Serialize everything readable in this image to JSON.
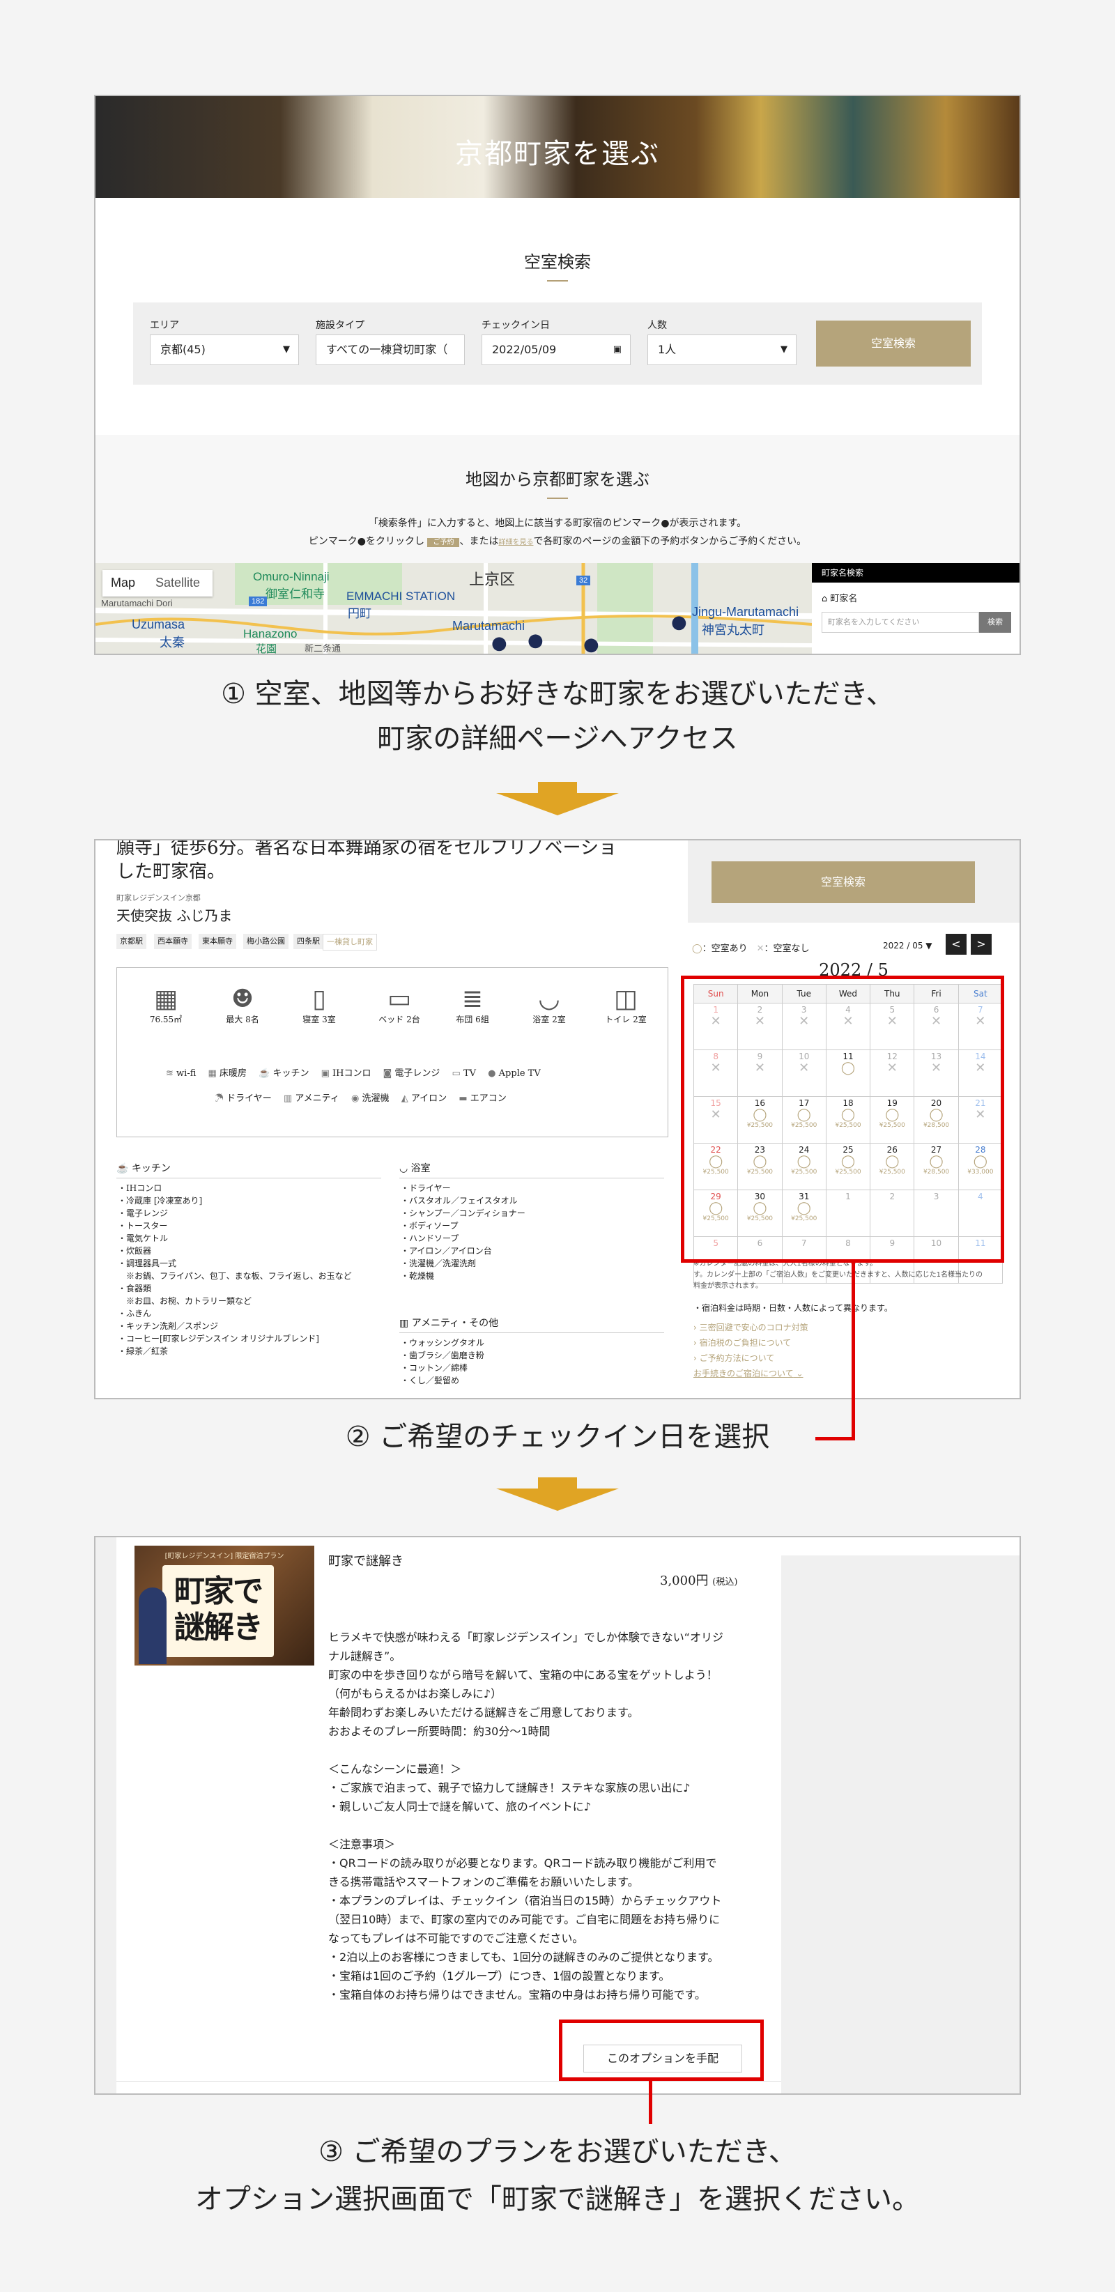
{
  "panel1": {
    "hero_title": "京都町家を選ぶ",
    "search_title": "空室検索",
    "fields": [
      {
        "label": "エリア",
        "value": "京都(45)"
      },
      {
        "label": "施設タイプ",
        "value": "すべての一棟貸切町家（"
      },
      {
        "label": "チェックイン日",
        "value": "2022/05/09"
      },
      {
        "label": "人数",
        "value": "1人"
      }
    ],
    "search_button": "空室検索",
    "map_section_title": "地図から京都町家を選ぶ",
    "map_instruction_1a": "「検索条件」に入力すると、地図上に該当する町家宿のピンマーク",
    "map_instruction_1b": "が表示されます。",
    "map_instruction_2a": "ピンマーク",
    "map_instruction_2b": "をクリックし",
    "map_instruction_2_badge": "ご予約",
    "map_instruction_2c": "、または",
    "map_instruction_2_link": "詳細を見る",
    "map_instruction_2d": "で各町家のページの金額下の予約ボタンからご予約ください。",
    "map_tabs": [
      "Map",
      "Satellite"
    ],
    "map_labels": [
      "Marutamachi Dori",
      "Omuro-Ninnaji",
      "御室仁和寺",
      "EMMACHI STATION",
      "円町",
      "上京区",
      "Uzumasa",
      "太秦",
      "Hanazono",
      "花園",
      "新二条通",
      "Marutamachi",
      "Jingu-Marutamachi",
      "神宮丸太町",
      "182",
      "32"
    ],
    "side_title": "町家名検索",
    "side_label": "町家名",
    "side_placeholder": "町家名を入力してください",
    "side_button": "検索"
  },
  "caption1_line1": "① 空室、地図等からお好きな町家をお選びいただき、",
  "caption1_line2": "町家の詳細ページへアクセス",
  "panel2": {
    "intro_line1": "願寺」徒歩6分。著名な日本舞踊家の宿をセルフリノベーショ",
    "intro_line2": "した町家宿。",
    "brand": "町家レジデンスイン京都",
    "name": "天使突抜 ふじ乃ま",
    "tags": [
      "京都駅",
      "西本願寺",
      "東本願寺",
      "梅小路公園",
      "四条駅",
      "一棟貸し町家"
    ],
    "specs": [
      {
        "icon": "floor-plan-icon",
        "label": "76.55㎡"
      },
      {
        "icon": "guests-icon",
        "label": "最大 8名"
      },
      {
        "icon": "bedroom-icon",
        "label": "寝室 3室"
      },
      {
        "icon": "bed-icon",
        "label": "ベッド 2台"
      },
      {
        "icon": "futon-icon",
        "label": "布団 6組"
      },
      {
        "icon": "bathtub-icon",
        "label": "浴室 2室"
      },
      {
        "icon": "toilet-icon",
        "label": "トイレ 2室"
      }
    ],
    "features_row1": [
      "wi-fi",
      "床暖房",
      "キッチン",
      "IHコンロ",
      "電子レンジ",
      "TV",
      "Apple TV"
    ],
    "features_row2": [
      "ドライヤー",
      "アメニティ",
      "洗濯機",
      "アイロン",
      "エアコン"
    ],
    "kitchen_title": "キッチン",
    "kitchen_items": [
      "・IHコンロ",
      "・冷蔵庫 [冷凍室あり]",
      "・電子レンジ",
      "・トースター",
      "・電気ケトル",
      "・炊飯器",
      "・調理器具一式",
      "　※お鍋、フライパン、包丁、まな板、フライ返し、お玉など",
      "・食器類",
      "　※お皿、お椀、カトラリー類など",
      "・ふきん",
      "・キッチン洗剤／スポンジ",
      "・コーヒー[町家レジデンスイン オリジナルブレンド]",
      "・緑茶／紅茶"
    ],
    "bath_title": "浴室",
    "bath_items": [
      "・ドライヤー",
      "・バスタオル／フェイスタオル",
      "・シャンプー／コンディショナー",
      "・ボディソープ",
      "・ハンドソープ",
      "・アイロン／アイロン台",
      "・洗濯機／洗濯洗剤",
      "・乾燥機"
    ],
    "amenity_title": "アメニティ・その他",
    "amenity_items": [
      "・ウォッシングタオル",
      "・歯ブラシ／歯磨き粉",
      "・コットン／綿棒",
      "・くし／髪留め"
    ],
    "search_button": "空室検索",
    "legend_available": "：空室あり",
    "legend_unavailable": "：空室なし",
    "month_select": "2022 / 05",
    "prev": "<",
    "next": ">",
    "cal_title": "2022 / 5",
    "weekdays": [
      "Sun",
      "Mon",
      "Tue",
      "Wed",
      "Thu",
      "Fri",
      "Sat"
    ],
    "weeks": [
      [
        {
          "d": "1",
          "s": "x"
        },
        {
          "d": "2",
          "s": "x"
        },
        {
          "d": "3",
          "s": "x"
        },
        {
          "d": "4",
          "s": "x"
        },
        {
          "d": "5",
          "s": "x"
        },
        {
          "d": "6",
          "s": "x"
        },
        {
          "d": "7",
          "s": "x"
        }
      ],
      [
        {
          "d": "8",
          "s": "x"
        },
        {
          "d": "9",
          "s": "x"
        },
        {
          "d": "10",
          "s": "x"
        },
        {
          "d": "11",
          "s": "o",
          "p": ""
        },
        {
          "d": "12",
          "s": "x"
        },
        {
          "d": "13",
          "s": "x"
        },
        {
          "d": "14",
          "s": "x"
        }
      ],
      [
        {
          "d": "15",
          "s": "x"
        },
        {
          "d": "16",
          "s": "o",
          "p": "¥25,500"
        },
        {
          "d": "17",
          "s": "o",
          "p": "¥25,500"
        },
        {
          "d": "18",
          "s": "o",
          "p": "¥25,500"
        },
        {
          "d": "19",
          "s": "o",
          "p": "¥25,500"
        },
        {
          "d": "20",
          "s": "o",
          "p": "¥28,500"
        },
        {
          "d": "21",
          "s": "x"
        }
      ],
      [
        {
          "d": "22",
          "s": "o",
          "p": "¥25,500"
        },
        {
          "d": "23",
          "s": "o",
          "p": "¥25,500"
        },
        {
          "d": "24",
          "s": "o",
          "p": "¥25,500"
        },
        {
          "d": "25",
          "s": "o",
          "p": "¥25,500"
        },
        {
          "d": "26",
          "s": "o",
          "p": "¥25,500"
        },
        {
          "d": "27",
          "s": "o",
          "p": "¥28,500"
        },
        {
          "d": "28",
          "s": "o",
          "p": "¥33,000"
        }
      ],
      [
        {
          "d": "29",
          "s": "o",
          "p": "¥25,500"
        },
        {
          "d": "30",
          "s": "o",
          "p": "¥25,500"
        },
        {
          "d": "31",
          "s": "o",
          "p": "¥25,500"
        },
        {
          "d": "1",
          "s": ""
        },
        {
          "d": "2",
          "s": ""
        },
        {
          "d": "3",
          "s": ""
        },
        {
          "d": "4",
          "s": ""
        }
      ],
      [
        {
          "d": "5",
          "s": ""
        },
        {
          "d": "6",
          "s": ""
        },
        {
          "d": "7",
          "s": ""
        },
        {
          "d": "8",
          "s": ""
        },
        {
          "d": "9",
          "s": ""
        },
        {
          "d": "10",
          "s": ""
        },
        {
          "d": "11",
          "s": ""
        }
      ]
    ],
    "note_line1": "※カレンダー記載の料金は、大人1名様の料金となります。",
    "note_line2": "す。カレンダー上部の「ご宿泊人数」をご変更いただきますと、人数に応じた1名様当たりの",
    "note_line3": "料金が表示されます。",
    "price_note": "・宿泊料金は時期・日数・人数によって異なります。",
    "links": [
      "三密回避で安心のコロナ対策",
      "宿泊税のご負担について",
      "ご予約方法について",
      "お手続きのご宿泊について"
    ]
  },
  "caption2": "② ご希望のチェックイン日を選択",
  "panel3": {
    "image_title": "町家で謎解き",
    "image_header": "[町家レジデンスイン] 限定宿泊プラン",
    "plan_title": "町家で謎解き",
    "price": "3,000円",
    "tax": "(税込)",
    "description": "ヒラメキで快感が味わえる「町家レジデンスイン」でしか体験できない“オリジナル謎解き”。\n町家の中を歩き回りながら暗号を解いて、宝箱の中にある宝をゲットしよう！（何がもらえるかはお楽しみに♪）\n年齢問わずお楽しみいただける謎解きをご用意しております。\nおおよそのプレー所要時間：約30分～1時間\n\n＜こんなシーンに最適！＞\n・ご家族で泊まって、親子で協力して謎解き！ステキな家族の思い出に♪\n・親しいご友人同士で謎を解いて、旅のイベントに♪\n\n＜注意事項＞\n・QRコードの読み取りが必要となります。QRコード読み取り機能がご利用できる携帯電話やスマートフォンのご準備をお願いいたします。\n・本プランのプレイは、チェックイン（宿泊当日の15時）からチェックアウト（翌日10時）まで、町家の室内でのみ可能です。ご自宅に問題をお持ち帰りになってもプレイは不可能ですのでご注意ください。\n・2泊以上のお客様につきましても、1回分の謎解きのみのご提供となります。\n・宝箱は1回のご予約（1グループ）につき、1個の設置となります。\n・宝箱自体のお持ち帰りはできません。宝箱の中身はお持ち帰り可能です。",
    "option_button": "このオプションを手配"
  },
  "caption3_line1": "③ ご希望のプランをお選びいただき、",
  "caption3_line2": "オプション選択画面で「町家で謎解き」を選択ください。",
  "colors": {
    "accent": "#b5a47b",
    "highlight": "#e00000",
    "arrow": "#e0a424",
    "sun": "#e05050",
    "sat": "#4a7fd0"
  }
}
